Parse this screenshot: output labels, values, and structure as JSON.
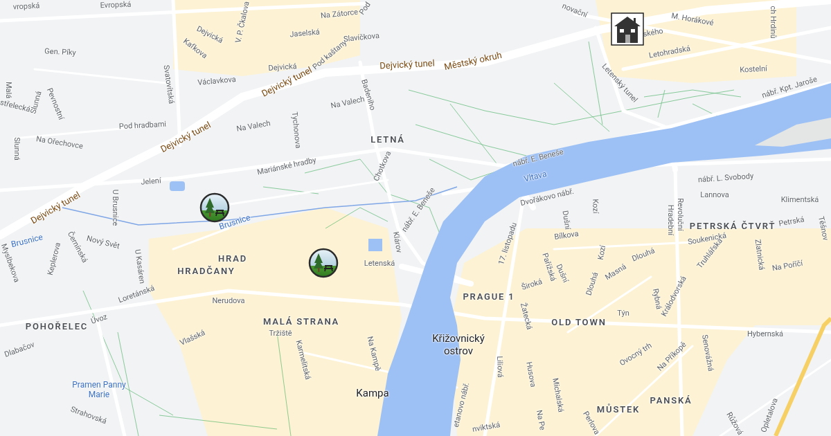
{
  "map": {
    "labels": [
      {
        "text": "vropská",
        "kind": "street"
      },
      {
        "text": "Evropská",
        "kind": "street"
      },
      {
        "text": "Gen. Píky",
        "kind": "street"
      },
      {
        "text": "Pevnostní",
        "kind": "street"
      },
      {
        "text": "Malá",
        "kind": "street"
      },
      {
        "text": "střelecká",
        "kind": "street"
      },
      {
        "text": "Slunná",
        "kind": "street"
      },
      {
        "text": "Slunná",
        "kind": "street"
      },
      {
        "text": "Na Ořechovce",
        "kind": "street"
      },
      {
        "text": "Pod hradbami",
        "kind": "street"
      },
      {
        "text": "Svatovítská",
        "kind": "street"
      },
      {
        "text": "Dejvická",
        "kind": "street"
      },
      {
        "text": "Kafkova",
        "kind": "street"
      },
      {
        "text": "V. P. Čkalova",
        "kind": "street"
      },
      {
        "text": "Jaselská",
        "kind": "street"
      },
      {
        "text": "Pod kaštany",
        "kind": "street"
      },
      {
        "text": "Dejvická",
        "kind": "street"
      },
      {
        "text": "Václavkova",
        "kind": "street"
      },
      {
        "text": "Slavíčkova",
        "kind": "street"
      },
      {
        "text": "Na Zátorce",
        "kind": "street"
      },
      {
        "text": "Pod",
        "kind": "street"
      },
      {
        "text": "Na Valech",
        "kind": "street"
      },
      {
        "text": "Na Valech",
        "kind": "street"
      },
      {
        "text": "Tychonova",
        "kind": "street"
      },
      {
        "text": "Badeniho",
        "kind": "street"
      },
      {
        "text": "Dejvický tunel",
        "kind": "motorway"
      },
      {
        "text": "Dejvický tunel",
        "kind": "motorway"
      },
      {
        "text": "Dejvický tunel",
        "kind": "motorway"
      },
      {
        "text": "Dejvický tunel",
        "kind": "motorway"
      },
      {
        "text": "Městský okruh",
        "kind": "motorway"
      },
      {
        "text": "LETNÁ",
        "kind": "district"
      },
      {
        "text": "Mariánské hradby",
        "kind": "street"
      },
      {
        "text": "Jelení",
        "kind": "street"
      },
      {
        "text": "U Brusnice",
        "kind": "street"
      },
      {
        "text": "Chotkova",
        "kind": "street"
      },
      {
        "text": "Brusnice",
        "kind": "water"
      },
      {
        "text": "Brusnice",
        "kind": "water"
      },
      {
        "text": "nábř. E. Beneše",
        "kind": "street"
      },
      {
        "text": "nábř. E. Beneše",
        "kind": "street"
      },
      {
        "text": "Vltava",
        "kind": "water"
      },
      {
        "text": "Dvořákovo nábř.",
        "kind": "street"
      },
      {
        "text": "Letenský tunel",
        "kind": "street"
      },
      {
        "text": "Letohradská",
        "kind": "street"
      },
      {
        "text": "M. Horákové",
        "kind": "street"
      },
      {
        "text": "ského",
        "kind": "street"
      },
      {
        "text": "Kostelní",
        "kind": "street"
      },
      {
        "text": "nábř. Kpt. Jaroše",
        "kind": "street"
      },
      {
        "text": "ch Hrdinů",
        "kind": "street"
      },
      {
        "text": "novační",
        "kind": "street"
      },
      {
        "text": "nábř. L. Svobody",
        "kind": "street"
      },
      {
        "text": "Lannova",
        "kind": "street"
      },
      {
        "text": "Klimentská",
        "kind": "street"
      },
      {
        "text": "Kozí",
        "kind": "street"
      },
      {
        "text": "Revoluční",
        "kind": "street"
      },
      {
        "text": "Hradební",
        "kind": "street"
      },
      {
        "text": "Myslbekova",
        "kind": "street"
      },
      {
        "text": "Keplerova",
        "kind": "street"
      },
      {
        "text": "Černínská",
        "kind": "street"
      },
      {
        "text": "Nový Svět",
        "kind": "street"
      },
      {
        "text": "U Kasáren",
        "kind": "street"
      },
      {
        "text": "HRAD",
        "kind": "district"
      },
      {
        "text": "HRADČANY",
        "kind": "district"
      },
      {
        "text": "Loretánská",
        "kind": "street"
      },
      {
        "text": "Nerudova",
        "kind": "street"
      },
      {
        "text": "Úvoz",
        "kind": "street"
      },
      {
        "text": "POHOŘELEC",
        "kind": "district"
      },
      {
        "text": "Dlabačov",
        "kind": "street"
      },
      {
        "text": "Vlašská",
        "kind": "street"
      },
      {
        "text": "Pramen Panny Marie",
        "kind": "water"
      },
      {
        "text": "Strahovská",
        "kind": "street"
      },
      {
        "text": "MALÁ STRANA",
        "kind": "district"
      },
      {
        "text": "Tržiště",
        "kind": "street"
      },
      {
        "text": "Karmelitská",
        "kind": "street"
      },
      {
        "text": "Letenská",
        "kind": "street"
      },
      {
        "text": "Klárov",
        "kind": "street"
      },
      {
        "text": "Na Kampě",
        "kind": "street"
      },
      {
        "text": "Kampa",
        "kind": "place"
      },
      {
        "text": "Křižovnický ostrov",
        "kind": "place"
      },
      {
        "text": "PRAGUE 1",
        "kind": "district"
      },
      {
        "text": "17. listopadu",
        "kind": "street"
      },
      {
        "text": "Široká",
        "kind": "street"
      },
      {
        "text": "Pařížská",
        "kind": "street"
      },
      {
        "text": "Žatecká",
        "kind": "street"
      },
      {
        "text": "Liliová",
        "kind": "street"
      },
      {
        "text": "Husova",
        "kind": "street"
      },
      {
        "text": "Michalská",
        "kind": "street"
      },
      {
        "text": "Na Pe",
        "kind": "street"
      },
      {
        "text": "Dušní",
        "kind": "street"
      },
      {
        "text": "Dlouhá",
        "kind": "street"
      },
      {
        "text": "Kozí",
        "kind": "street"
      },
      {
        "text": "Masná",
        "kind": "street"
      },
      {
        "text": "Dlouhá",
        "kind": "street"
      },
      {
        "text": "Bílkova",
        "kind": "street"
      },
      {
        "text": "Dušní",
        "kind": "street"
      },
      {
        "text": "Týn",
        "kind": "street"
      },
      {
        "text": "OLD TOWN",
        "kind": "district"
      },
      {
        "text": "Rybná",
        "kind": "street"
      },
      {
        "text": "Králodvorská",
        "kind": "street"
      },
      {
        "text": "Soukenická",
        "kind": "street"
      },
      {
        "text": "Truhlářská",
        "kind": "street"
      },
      {
        "text": "Zlatnická",
        "kind": "street"
      },
      {
        "text": "Na Poříčí",
        "kind": "street"
      },
      {
        "text": "PETRSKÁ ČTVRŤ",
        "kind": "district"
      },
      {
        "text": "Petrská",
        "kind": "street"
      },
      {
        "text": "Těšnov",
        "kind": "street"
      },
      {
        "text": "Hybernská",
        "kind": "street"
      },
      {
        "text": "Ovocný trh",
        "kind": "street"
      },
      {
        "text": "Na Příkopě",
        "kind": "street"
      },
      {
        "text": "Senovážná",
        "kind": "street"
      },
      {
        "text": "PANSKÁ",
        "kind": "district"
      },
      {
        "text": "MŮSTEK",
        "kind": "district"
      },
      {
        "text": "Růžová",
        "kind": "street"
      },
      {
        "text": "Opletalova",
        "kind": "street"
      },
      {
        "text": "Perlova",
        "kind": "street"
      },
      {
        "text": "nviktská",
        "kind": "street"
      },
      {
        "text": "etanovo nábř.",
        "kind": "street"
      }
    ],
    "markers": [
      {
        "kind": "picnic"
      },
      {
        "kind": "picnic"
      },
      {
        "kind": "home"
      }
    ]
  }
}
